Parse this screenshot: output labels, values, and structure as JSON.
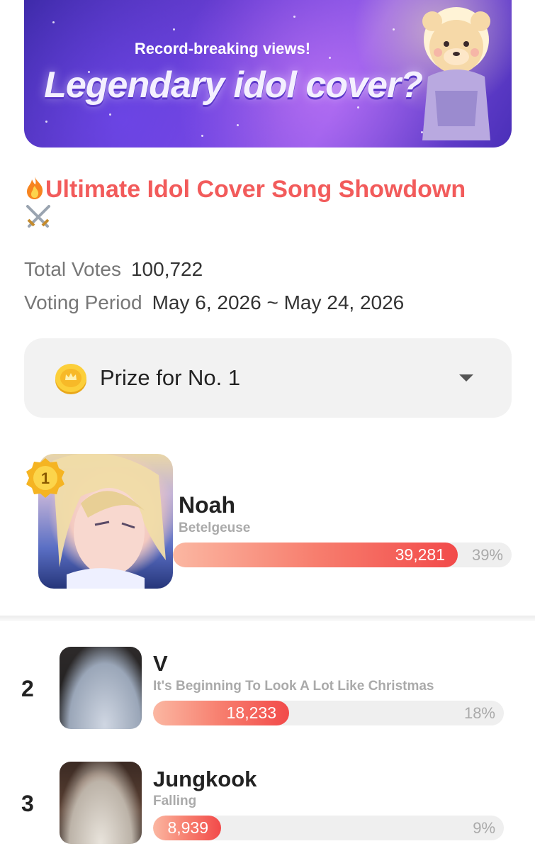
{
  "banner": {
    "subtitle": "Record-breaking views!",
    "title": "Legendary idol cover?"
  },
  "event": {
    "title": "Ultimate Idol Cover Song Showdown",
    "total_votes_label": "Total Votes",
    "total_votes": "100,722",
    "voting_period_label": "Voting Period",
    "voting_period": "May 6, 2026 ~ May 24, 2026"
  },
  "prize": {
    "label": "Prize for No. 1"
  },
  "ranking": [
    {
      "rank": "1",
      "name": "Noah",
      "song": "Betelgeuse",
      "votes": "39,281",
      "percent": "39%",
      "share": 0.39
    },
    {
      "rank": "2",
      "name": "V",
      "song": "It's Beginning To Look A Lot Like Christmas",
      "votes": "18,233",
      "percent": "18%",
      "share": 0.18
    },
    {
      "rank": "3",
      "name": "Jungkook",
      "song": "Falling",
      "votes": "8,939",
      "percent": "9%",
      "share": 0.09
    }
  ],
  "colors": {
    "title": "#f25b5b",
    "bar_start": "#fbb7a2",
    "bar_end": "#f24a4a",
    "track": "#efefef"
  },
  "icons": {
    "title_prefix": "fire-icon",
    "title_suffix": "crossed-swords-icon",
    "prize": "coin-icon",
    "dropdown": "caret-down-icon",
    "rank_badge": "gold-badge-icon"
  }
}
